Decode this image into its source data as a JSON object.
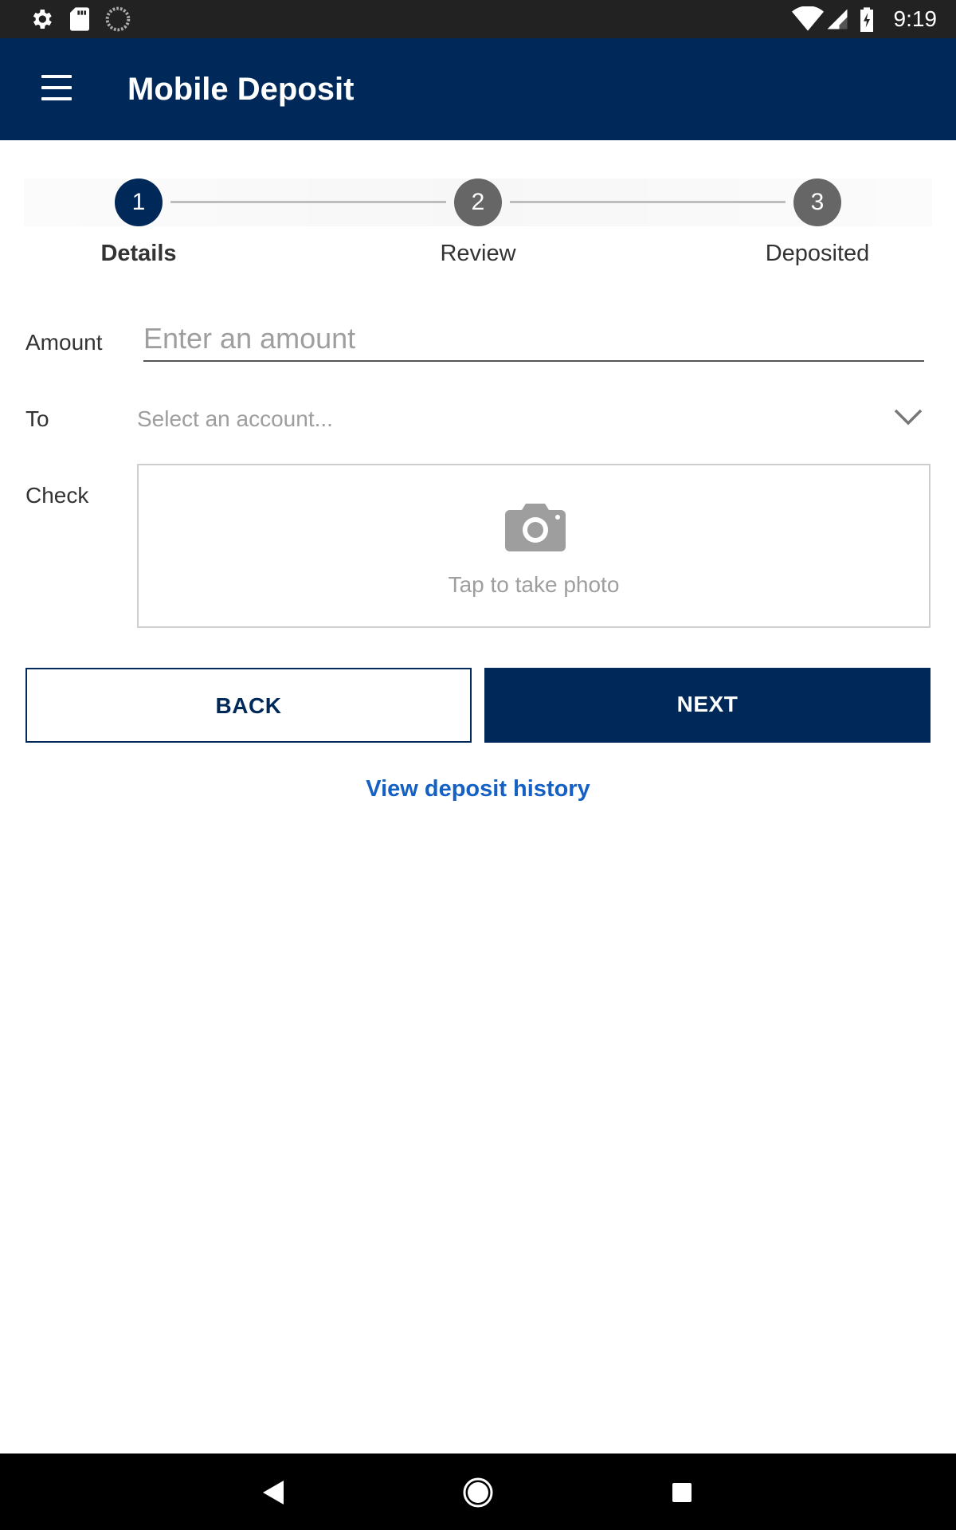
{
  "status_bar": {
    "time": "9:19",
    "icons": [
      "settings-icon",
      "sd-card-icon",
      "sync-icon",
      "wifi-icon",
      "signal-icon",
      "battery-icon"
    ]
  },
  "app_bar": {
    "title": "Mobile Deposit",
    "menu_icon": "hamburger-menu-icon",
    "background": "#00295a"
  },
  "stepper": {
    "steps": [
      {
        "number": "1",
        "label": "Details",
        "state": "active"
      },
      {
        "number": "2",
        "label": "Review",
        "state": "inactive"
      },
      {
        "number": "3",
        "label": "Deposited",
        "state": "inactive"
      }
    ]
  },
  "form": {
    "amount": {
      "label": "Amount",
      "placeholder": "Enter an amount",
      "value": ""
    },
    "to": {
      "label": "To",
      "placeholder": "Select an account...",
      "icon": "chevron-down-icon"
    },
    "check": {
      "label": "Check",
      "hint": "Tap to take photo",
      "icon": "camera-icon"
    }
  },
  "actions": {
    "back_label": "BACK",
    "next_label": "NEXT"
  },
  "links": {
    "history_label": "View deposit history",
    "color": "#1460c4"
  },
  "nav_bar": {
    "buttons": [
      "back-nav-icon",
      "home-nav-icon",
      "recents-nav-icon"
    ]
  }
}
